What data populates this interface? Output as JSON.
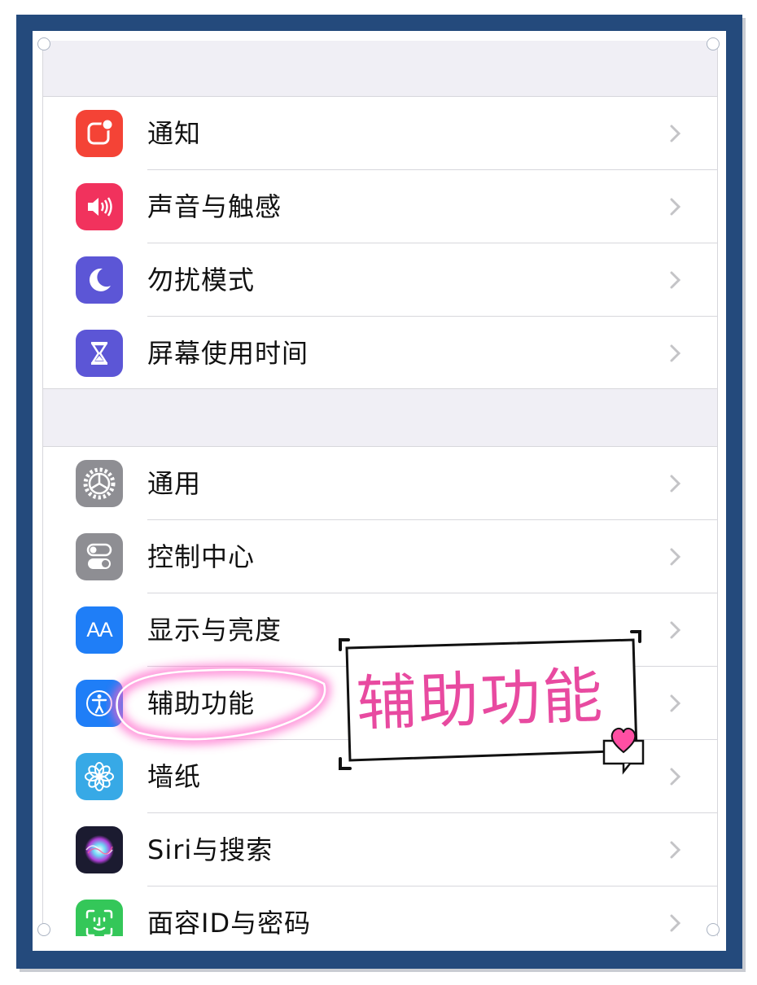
{
  "colors": {
    "frame": "#244a7c",
    "group_bg": "#f0eff5",
    "accent_pink": "#e84aa0"
  },
  "group1": [
    {
      "label": "通知",
      "icon": "notification-icon",
      "color": "#f44336"
    },
    {
      "label": "声音与触感",
      "icon": "speaker-icon",
      "color": "#f1325d"
    },
    {
      "label": "勿扰模式",
      "icon": "moon-icon",
      "color": "#5c56d6"
    },
    {
      "label": "屏幕使用时间",
      "icon": "hourglass-icon",
      "color": "#5c56d6"
    }
  ],
  "group2": [
    {
      "label": "通用",
      "icon": "gear-icon",
      "color": "#8e8e93"
    },
    {
      "label": "控制中心",
      "icon": "toggles-icon",
      "color": "#8e8e93"
    },
    {
      "label": "显示与亮度",
      "icon": "aa-text-icon",
      "color": "#1f7ef7",
      "icon_text": "AA"
    },
    {
      "label": "辅助功能",
      "icon": "accessibility-icon",
      "color": "#1f7ef7"
    },
    {
      "label": "墙纸",
      "icon": "flower-icon",
      "color": "#37a9e6"
    },
    {
      "label": "Siri与搜索",
      "icon": "siri-icon",
      "color": "#1b1b30"
    },
    {
      "label": "面容ID与密码",
      "icon": "face-id-icon",
      "color": "#34c759"
    }
  ],
  "annotation": {
    "text": "辅助功能"
  }
}
